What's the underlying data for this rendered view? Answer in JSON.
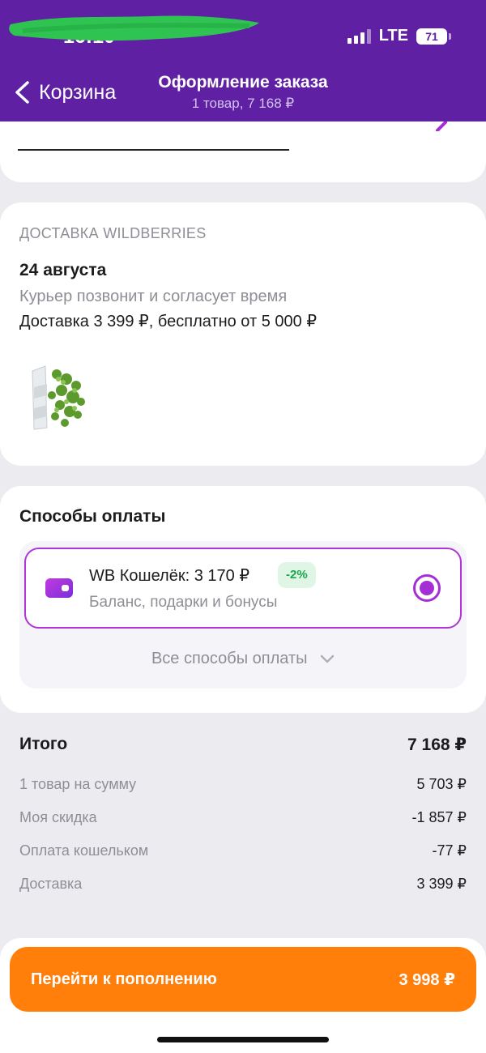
{
  "status_bar": {
    "time": "16:10",
    "network": "LTE",
    "battery": "71"
  },
  "nav": {
    "back_label": "Корзина",
    "title": "Оформление заказа",
    "subtitle": "1 товар, 7 168 ₽"
  },
  "delivery": {
    "caption": "ДОСТАВКА WILDBERRIES",
    "date": "24 августа",
    "note": "Курьер позвонит и согласует время",
    "price_text": "Доставка 3 399 ₽, бесплатно от 5 000 ₽"
  },
  "payment": {
    "title": "Способы оплаты",
    "wallet_name": "WB Кошелёк: 3 170 ₽",
    "discount_badge": "-2%",
    "wallet_desc": "Баланс, подарки и бонусы",
    "all_methods": "Все способы оплаты",
    "selected": true
  },
  "summary": {
    "total_label": "Итого",
    "total_value": "7 168 ₽",
    "lines": [
      {
        "label": "1 товар на сумму",
        "value": "5 703 ₽"
      },
      {
        "label": "Моя скидка",
        "value": "-1 857 ₽"
      },
      {
        "label": "Оплата кошельком",
        "value": "-77 ₽"
      },
      {
        "label": "Доставка",
        "value": "3 399 ₽"
      }
    ]
  },
  "cta": {
    "label": "Перейти к пополнению",
    "amount": "3 998 ₽"
  },
  "colors": {
    "header": "#5f20a3",
    "accent": "#a52fd6",
    "cta": "#ff7f0a",
    "discount": "#1aa64b",
    "redaction": "#2fc452"
  },
  "icons": [
    "chevron-left-icon",
    "signal-icon",
    "battery-icon",
    "pencil-icon",
    "wallet-icon",
    "chevron-down-icon",
    "radio-selected-icon"
  ]
}
